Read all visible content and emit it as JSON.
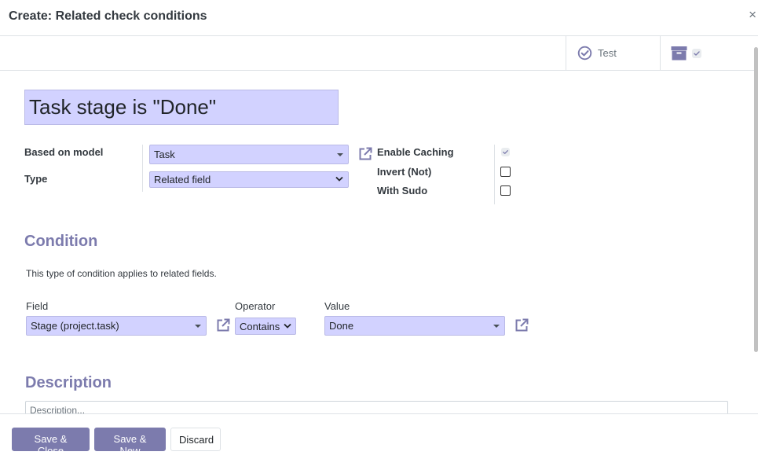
{
  "dialog": {
    "title": "Create: Related check conditions",
    "close_glyph": "×"
  },
  "button_box": {
    "test_label": "Test",
    "test_icon": "check-circle-icon",
    "archive_icon": "archive-icon"
  },
  "form": {
    "name_value": "Task stage is \"Done\"",
    "based_on_model_label": "Based on model",
    "based_on_model_value": "Task",
    "type_label": "Type",
    "type_value": "Related field",
    "enable_caching_label": "Enable Caching",
    "enable_caching_checked": true,
    "invert_label": "Invert (Not)",
    "invert_checked": false,
    "with_sudo_label": "With Sudo",
    "with_sudo_checked": false
  },
  "condition": {
    "title": "Condition",
    "help": "This type of condition applies to related fields.",
    "field_label": "Field",
    "field_value": "Stage (project.task)",
    "operator_label": "Operator",
    "operator_value": "Contains",
    "value_label": "Value",
    "value_value": "Done"
  },
  "description": {
    "title": "Description",
    "placeholder": "Description..."
  },
  "footer": {
    "save_close": "Save & Close",
    "save_new": "Save & New",
    "discard": "Discard"
  },
  "colors": {
    "accent": "#7c7bad",
    "input_bg": "#d2d2ff",
    "link_icon": "#7c7bad"
  }
}
